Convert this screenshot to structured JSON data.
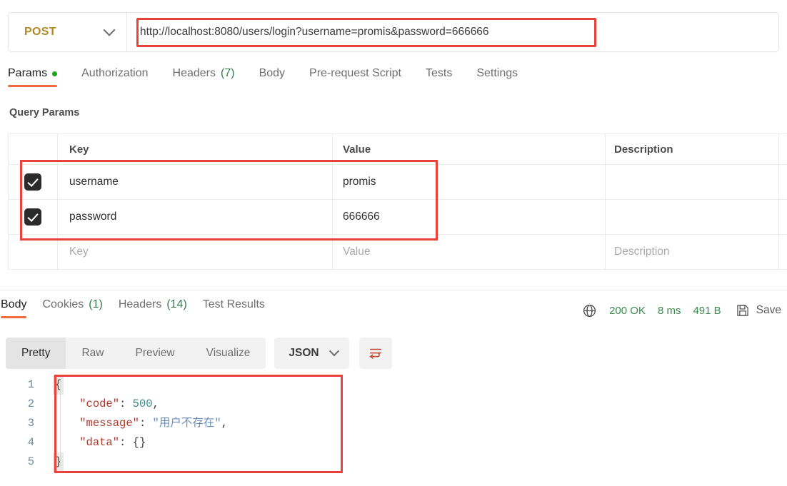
{
  "request": {
    "method": "POST",
    "url": "http://localhost:8080/users/login?username=promis&password=666666",
    "method_chevron_icon": "chevron-down-icon",
    "tabs": [
      {
        "label": "Params",
        "badge": "",
        "active": true,
        "dot": true
      },
      {
        "label": "Authorization",
        "badge": "",
        "active": false,
        "dot": false
      },
      {
        "label": "Headers",
        "badge": "(7)",
        "active": false,
        "dot": false
      },
      {
        "label": "Body",
        "badge": "",
        "active": false,
        "dot": false
      },
      {
        "label": "Pre-request Script",
        "badge": "",
        "active": false,
        "dot": false
      },
      {
        "label": "Tests",
        "badge": "",
        "active": false,
        "dot": false
      },
      {
        "label": "Settings",
        "badge": "",
        "active": false,
        "dot": false
      }
    ]
  },
  "params": {
    "section_title": "Query Params",
    "columns": {
      "key": "Key",
      "value": "Value",
      "description": "Description"
    },
    "rows": [
      {
        "checked": true,
        "key": "username",
        "value": "promis",
        "description": ""
      },
      {
        "checked": true,
        "key": "password",
        "value": "666666",
        "description": ""
      }
    ],
    "placeholder_row": {
      "key": "Key",
      "value": "Value",
      "description": "Description"
    }
  },
  "response": {
    "tabs": [
      {
        "label": "Body",
        "badge": "",
        "active": true
      },
      {
        "label": "Cookies",
        "badge": "(1)",
        "active": false
      },
      {
        "label": "Headers",
        "badge": "(14)",
        "active": false
      },
      {
        "label": "Test Results",
        "badge": "",
        "active": false
      }
    ],
    "status": {
      "globe_icon": "globe-icon",
      "code": "200 OK",
      "time": "8 ms",
      "size": "491 B",
      "save_icon": "floppy-disk-icon",
      "save_label": "Save"
    },
    "view_modes": [
      {
        "label": "Pretty",
        "active": true
      },
      {
        "label": "Raw",
        "active": false
      },
      {
        "label": "Preview",
        "active": false
      },
      {
        "label": "Visualize",
        "active": false
      }
    ],
    "format": {
      "label": "JSON",
      "chevron_icon": "chevron-down-icon"
    },
    "wrap_icon": "word-wrap-icon",
    "body": {
      "line_numbers": [
        "1",
        "2",
        "3",
        "4",
        "5"
      ],
      "lines": [
        {
          "open_brace": "{"
        },
        {
          "indent": "    ",
          "key": "\"code\"",
          "colon": ": ",
          "num": "500",
          "comma": ","
        },
        {
          "indent": "    ",
          "key": "\"message\"",
          "colon": ": ",
          "str": "\"用户不存在\"",
          "comma": ","
        },
        {
          "indent": "    ",
          "key": "\"data\"",
          "colon": ": ",
          "obj": "{}"
        },
        {
          "close_brace": "}"
        }
      ]
    }
  },
  "annotations": {
    "color": "#e8433a",
    "boxes": [
      "url-highlight",
      "params-rows-highlight",
      "json-body-highlight"
    ]
  }
}
